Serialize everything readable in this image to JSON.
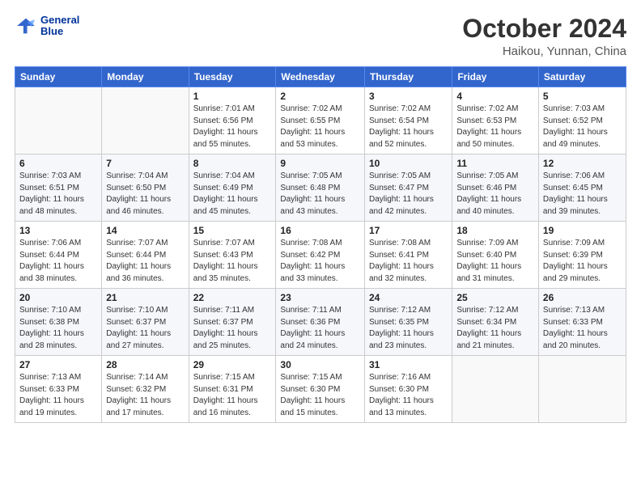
{
  "logo": {
    "line1": "General",
    "line2": "Blue"
  },
  "title": "October 2024",
  "location": "Haikou, Yunnan, China",
  "days_of_week": [
    "Sunday",
    "Monday",
    "Tuesday",
    "Wednesday",
    "Thursday",
    "Friday",
    "Saturday"
  ],
  "weeks": [
    [
      {
        "day": "",
        "info": ""
      },
      {
        "day": "",
        "info": ""
      },
      {
        "day": "1",
        "info": "Sunrise: 7:01 AM\nSunset: 6:56 PM\nDaylight: 11 hours and 55 minutes."
      },
      {
        "day": "2",
        "info": "Sunrise: 7:02 AM\nSunset: 6:55 PM\nDaylight: 11 hours and 53 minutes."
      },
      {
        "day": "3",
        "info": "Sunrise: 7:02 AM\nSunset: 6:54 PM\nDaylight: 11 hours and 52 minutes."
      },
      {
        "day": "4",
        "info": "Sunrise: 7:02 AM\nSunset: 6:53 PM\nDaylight: 11 hours and 50 minutes."
      },
      {
        "day": "5",
        "info": "Sunrise: 7:03 AM\nSunset: 6:52 PM\nDaylight: 11 hours and 49 minutes."
      }
    ],
    [
      {
        "day": "6",
        "info": "Sunrise: 7:03 AM\nSunset: 6:51 PM\nDaylight: 11 hours and 48 minutes."
      },
      {
        "day": "7",
        "info": "Sunrise: 7:04 AM\nSunset: 6:50 PM\nDaylight: 11 hours and 46 minutes."
      },
      {
        "day": "8",
        "info": "Sunrise: 7:04 AM\nSunset: 6:49 PM\nDaylight: 11 hours and 45 minutes."
      },
      {
        "day": "9",
        "info": "Sunrise: 7:05 AM\nSunset: 6:48 PM\nDaylight: 11 hours and 43 minutes."
      },
      {
        "day": "10",
        "info": "Sunrise: 7:05 AM\nSunset: 6:47 PM\nDaylight: 11 hours and 42 minutes."
      },
      {
        "day": "11",
        "info": "Sunrise: 7:05 AM\nSunset: 6:46 PM\nDaylight: 11 hours and 40 minutes."
      },
      {
        "day": "12",
        "info": "Sunrise: 7:06 AM\nSunset: 6:45 PM\nDaylight: 11 hours and 39 minutes."
      }
    ],
    [
      {
        "day": "13",
        "info": "Sunrise: 7:06 AM\nSunset: 6:44 PM\nDaylight: 11 hours and 38 minutes."
      },
      {
        "day": "14",
        "info": "Sunrise: 7:07 AM\nSunset: 6:44 PM\nDaylight: 11 hours and 36 minutes."
      },
      {
        "day": "15",
        "info": "Sunrise: 7:07 AM\nSunset: 6:43 PM\nDaylight: 11 hours and 35 minutes."
      },
      {
        "day": "16",
        "info": "Sunrise: 7:08 AM\nSunset: 6:42 PM\nDaylight: 11 hours and 33 minutes."
      },
      {
        "day": "17",
        "info": "Sunrise: 7:08 AM\nSunset: 6:41 PM\nDaylight: 11 hours and 32 minutes."
      },
      {
        "day": "18",
        "info": "Sunrise: 7:09 AM\nSunset: 6:40 PM\nDaylight: 11 hours and 31 minutes."
      },
      {
        "day": "19",
        "info": "Sunrise: 7:09 AM\nSunset: 6:39 PM\nDaylight: 11 hours and 29 minutes."
      }
    ],
    [
      {
        "day": "20",
        "info": "Sunrise: 7:10 AM\nSunset: 6:38 PM\nDaylight: 11 hours and 28 minutes."
      },
      {
        "day": "21",
        "info": "Sunrise: 7:10 AM\nSunset: 6:37 PM\nDaylight: 11 hours and 27 minutes."
      },
      {
        "day": "22",
        "info": "Sunrise: 7:11 AM\nSunset: 6:37 PM\nDaylight: 11 hours and 25 minutes."
      },
      {
        "day": "23",
        "info": "Sunrise: 7:11 AM\nSunset: 6:36 PM\nDaylight: 11 hours and 24 minutes."
      },
      {
        "day": "24",
        "info": "Sunrise: 7:12 AM\nSunset: 6:35 PM\nDaylight: 11 hours and 23 minutes."
      },
      {
        "day": "25",
        "info": "Sunrise: 7:12 AM\nSunset: 6:34 PM\nDaylight: 11 hours and 21 minutes."
      },
      {
        "day": "26",
        "info": "Sunrise: 7:13 AM\nSunset: 6:33 PM\nDaylight: 11 hours and 20 minutes."
      }
    ],
    [
      {
        "day": "27",
        "info": "Sunrise: 7:13 AM\nSunset: 6:33 PM\nDaylight: 11 hours and 19 minutes."
      },
      {
        "day": "28",
        "info": "Sunrise: 7:14 AM\nSunset: 6:32 PM\nDaylight: 11 hours and 17 minutes."
      },
      {
        "day": "29",
        "info": "Sunrise: 7:15 AM\nSunset: 6:31 PM\nDaylight: 11 hours and 16 minutes."
      },
      {
        "day": "30",
        "info": "Sunrise: 7:15 AM\nSunset: 6:30 PM\nDaylight: 11 hours and 15 minutes."
      },
      {
        "day": "31",
        "info": "Sunrise: 7:16 AM\nSunset: 6:30 PM\nDaylight: 11 hours and 13 minutes."
      },
      {
        "day": "",
        "info": ""
      },
      {
        "day": "",
        "info": ""
      }
    ]
  ]
}
